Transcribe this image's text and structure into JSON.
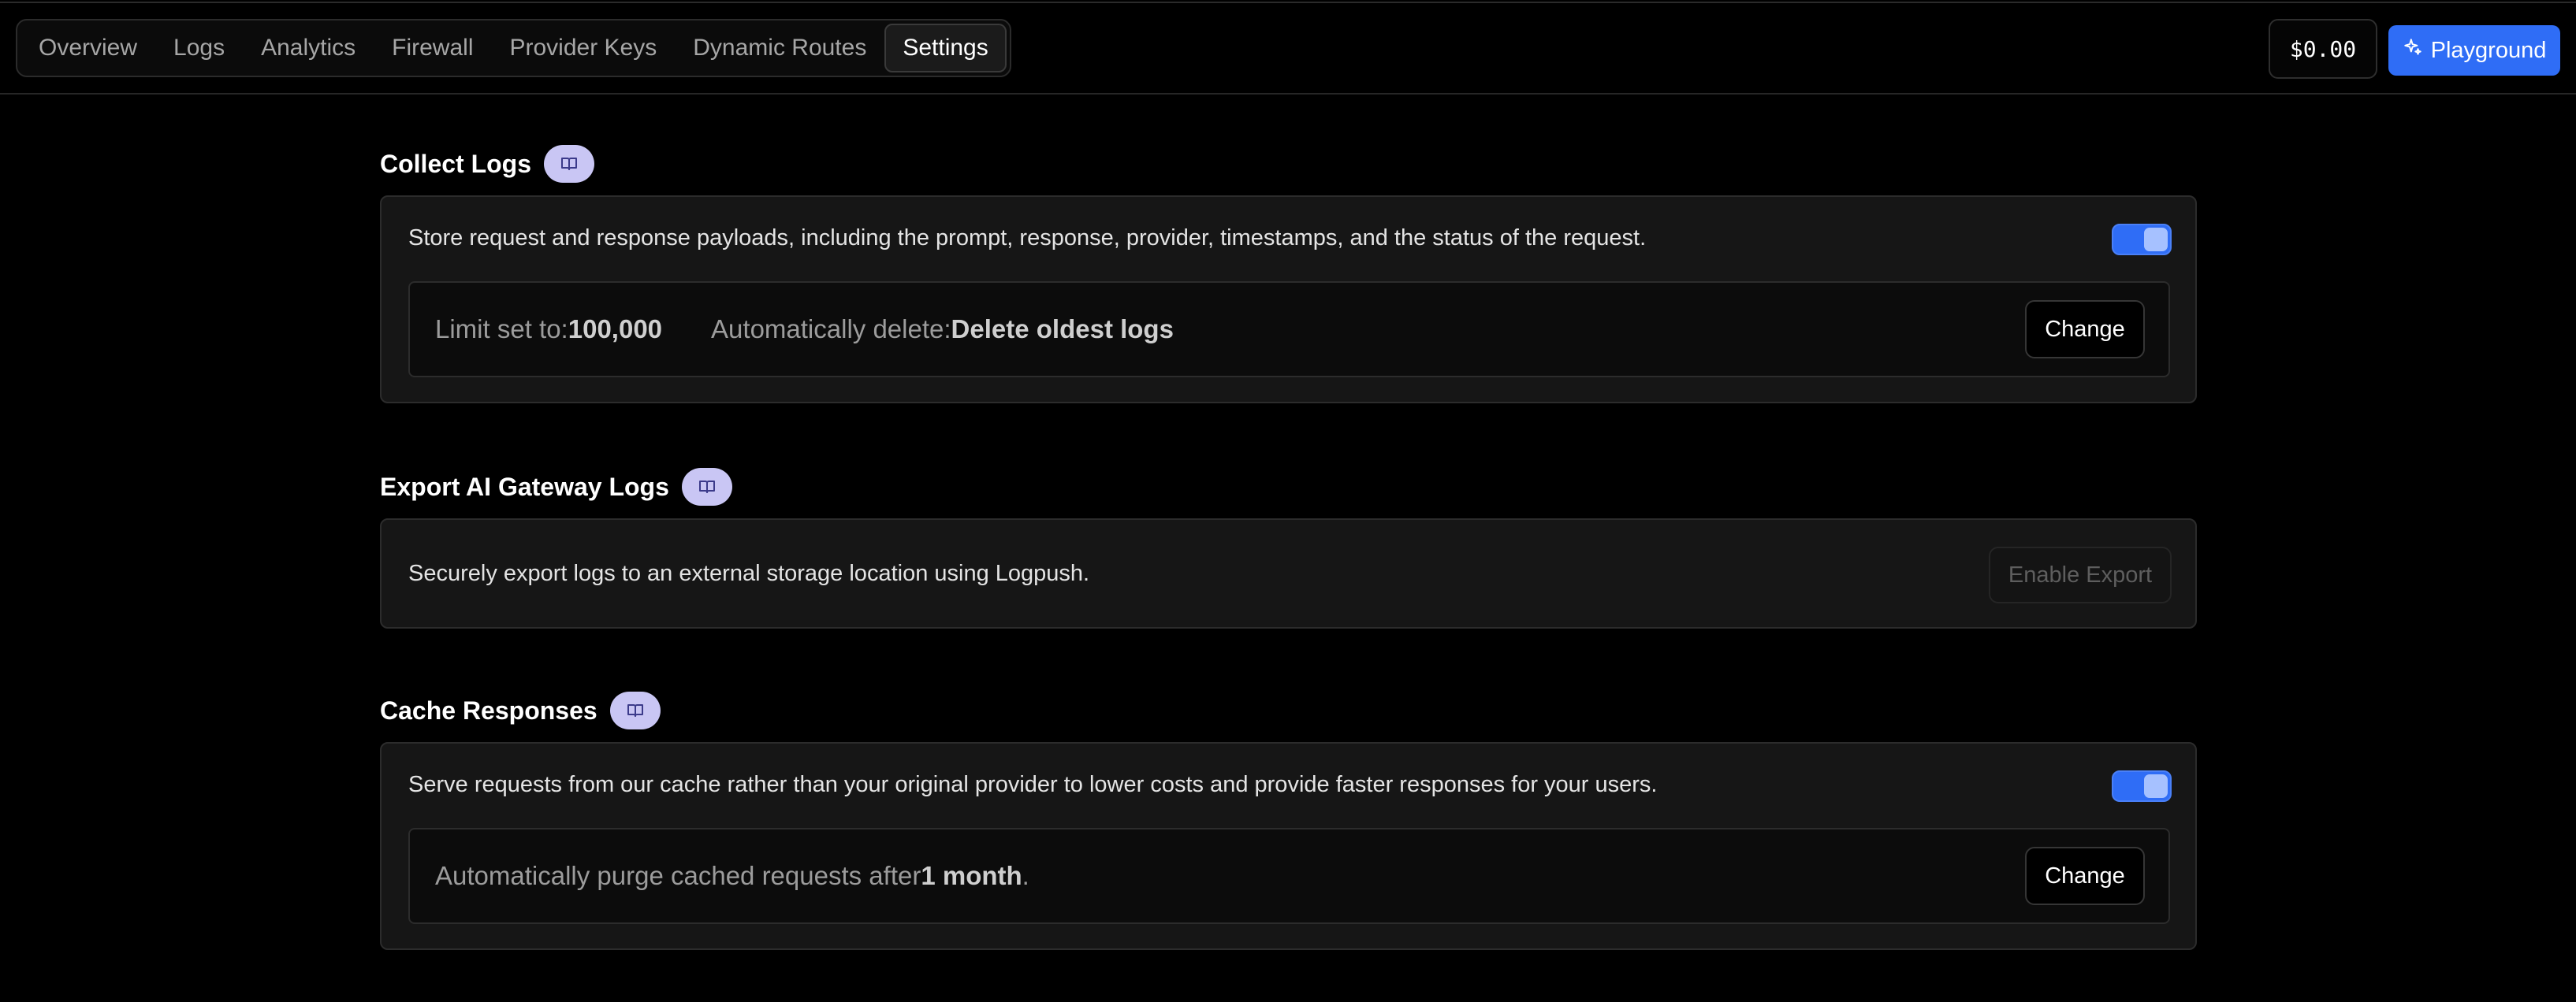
{
  "nav": {
    "tabs": [
      {
        "label": "Overview"
      },
      {
        "label": "Logs"
      },
      {
        "label": "Analytics"
      },
      {
        "label": "Firewall"
      },
      {
        "label": "Provider Keys"
      },
      {
        "label": "Dynamic Routes"
      },
      {
        "label": "Settings",
        "active": true
      }
    ],
    "balance": "$0.00",
    "playground_label": "Playground",
    "playground_icon": "sparkle-icon"
  },
  "colors": {
    "accent": "#2f6df6",
    "doc_pill": "#c9c6f4",
    "background": "#000000",
    "card": "#161616"
  },
  "collect_logs": {
    "title": "Collect Logs",
    "doc_icon": "book-icon",
    "description": "Store request and response payloads, including the prompt, response, provider, timestamps, and the status of the request.",
    "enabled": true,
    "limit_label": "Limit set to: ",
    "limit_value": "100,000",
    "delete_label": "Automatically delete: ",
    "delete_value": "Delete oldest logs",
    "change_label": "Change"
  },
  "export_logs": {
    "title": "Export AI Gateway Logs",
    "doc_icon": "book-icon",
    "description": "Securely export logs to an external storage location using Logpush.",
    "button_label": "Enable Export"
  },
  "cache_responses": {
    "title": "Cache Responses",
    "doc_icon": "book-icon",
    "description": "Serve requests from our cache rather than your original provider to lower costs and provide faster responses for your users.",
    "enabled": true,
    "purge_label": "Automatically purge cached requests after ",
    "purge_value": "1 month",
    "purge_suffix": ".",
    "change_label": "Change"
  }
}
